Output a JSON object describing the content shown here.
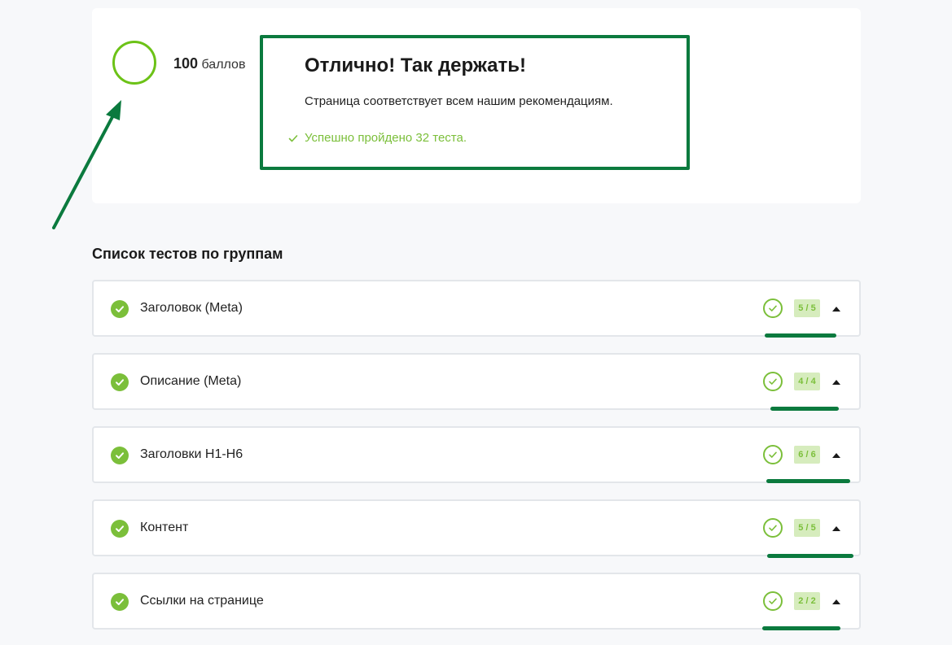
{
  "score": {
    "value": "100",
    "unit": "баллов"
  },
  "result": {
    "title": "Отлично! Так держать!",
    "description": "Страница соответствует всем нашим рекомендациям.",
    "passed_text": "Успешно пройдено 32 теста."
  },
  "section": {
    "title": "Список тестов по группам"
  },
  "groups": [
    {
      "name": "Заголовок (Meta)",
      "count": "5 / 5"
    },
    {
      "name": "Описание (Meta)",
      "count": "4 / 4"
    },
    {
      "name": "Заголовки H1-H6",
      "count": "6 / 6"
    },
    {
      "name": "Контент",
      "count": "5 / 5"
    },
    {
      "name": "Ссылки на странице",
      "count": "2 / 2"
    }
  ],
  "colors": {
    "accent_green": "#7bbf3a",
    "ring_green": "#6cc217",
    "annotation_green": "#0b7a3e",
    "count_bg": "#d6ecbd"
  },
  "icons": {
    "passed": "check-icon",
    "group_status": "check-circle-icon",
    "group_ring": "check-ring-icon",
    "toggle": "caret-up-icon"
  }
}
